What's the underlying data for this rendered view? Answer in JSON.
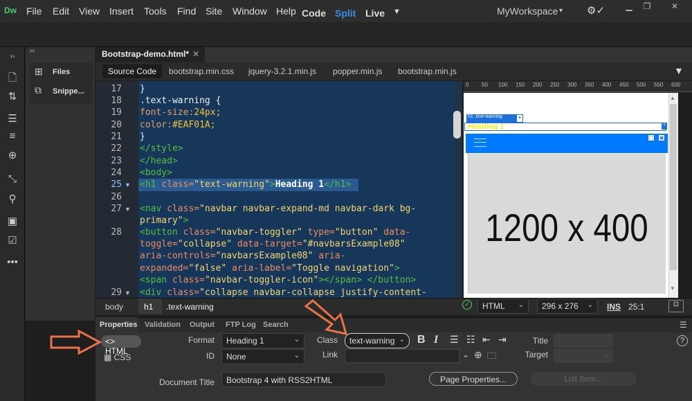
{
  "app": {
    "logo": "Dw"
  },
  "menu": [
    "File",
    "Edit",
    "View",
    "Insert",
    "Tools",
    "Find",
    "Site",
    "Window",
    "Help"
  ],
  "workspace": "MyWorkspace",
  "view_modes": {
    "code": "Code",
    "split": "Split",
    "live": "Live"
  },
  "files_panel": {
    "files": "Files",
    "snippets": "Snippe..."
  },
  "document": {
    "tab": "Bootstrap-demo.html*"
  },
  "related_files": [
    "Source Code",
    "bootstrap.min.css",
    "jquery-3.2.1.min.js",
    "popper.min.js",
    "bootstrap.min.js"
  ],
  "code_lines": {
    "l17": "17",
    "l18": "18",
    "l19": "19",
    "l20": "20",
    "l21": "21",
    "l22": "22",
    "l23": "23",
    "l24": "24",
    "l25": "25",
    "l26": "26",
    "l27": "27",
    "l28": "28",
    "l29": "29"
  },
  "code": {
    "c17": "}",
    "c18": ".text-warning {",
    "c19a": "font-size:",
    "c19b": "24px;",
    "c20a": "color:",
    "c20b": "#EAF01A;",
    "c21": "}",
    "c22": "</style>",
    "c23": "</head>",
    "c24": "<body>",
    "c25a": "<h1 ",
    "c25b": "class=",
    "c25c": "\"text-warning\"",
    "c25d": ">",
    "c25e": "Heading 1",
    "c25f": "</h1>",
    "c27a": "<nav ",
    "c27b": "class=",
    "c27c": "\"navbar navbar-expand-md navbar-dark bg-",
    "c27d": "primary\"",
    "c27e": ">",
    "c28a": "<button ",
    "c28b": "class=",
    "c28c": "\"navbar-toggler\"",
    "c28d": " type=",
    "c28e": "\"button\"",
    "c28f": " data-",
    "c28g": "toggle=",
    "c28h": "\"collapse\"",
    "c28i": " data-target=",
    "c28j": "\"#navbarsExample08\"",
    "c28k": "aria-controls=",
    "c28l": "\"navbarsExample08\"",
    "c28m": " aria-",
    "c28n": "expanded=",
    "c28o": "\"false\"",
    "c28p": " aria-label=",
    "c28q": "\"Toggle navigation\"",
    "c28r": ">",
    "c28s": "<span ",
    "c28t": "class=",
    "c28u": "\"navbar-toggler-icon\"",
    "c28v": "></span> </button>",
    "c29a": "<div ",
    "c29b": "class=",
    "c29c": "\"collapse navbar-collapse justify-content-"
  },
  "ruler_ticks": [
    "0",
    "50",
    "100",
    "150",
    "200",
    "250",
    "300",
    "350",
    "400",
    "450",
    "500",
    "550",
    "600"
  ],
  "live_view": {
    "tag_label": "h1 .text-warning",
    "heading": "Heading 1",
    "image_label": "1200 x 400"
  },
  "breadcrumb": {
    "body": "body",
    "h1": "h1",
    "class": ".text-warning"
  },
  "status": {
    "doc_type": "HTML",
    "size": "296 x 276",
    "ins": "INS",
    "position": "25:1"
  },
  "panel_tabs": [
    "Properties",
    "Validation",
    "Output",
    "FTP Log",
    "Search"
  ],
  "properties": {
    "html_btn": "HTML",
    "css_btn": "CSS",
    "format_label": "Format",
    "format_value": "Heading 1",
    "id_label": "ID",
    "id_value": "None",
    "class_label": "Class",
    "class_value": "text-warning",
    "link_label": "Link",
    "bold": "B",
    "italic": "I",
    "title_label": "Title",
    "target_label": "Target",
    "doc_title_label": "Document Title",
    "doc_title_value": "Bootstrap 4 with RSS2HTML",
    "page_props": "Page Properties...",
    "list_item": "List Item..."
  },
  "colors": {
    "accent": "#3a8ee6",
    "code_bg": "#16365a",
    "annotation_arrow": "#e8734a",
    "warning_text": "#eaf01a",
    "navbar": "#007bff"
  }
}
